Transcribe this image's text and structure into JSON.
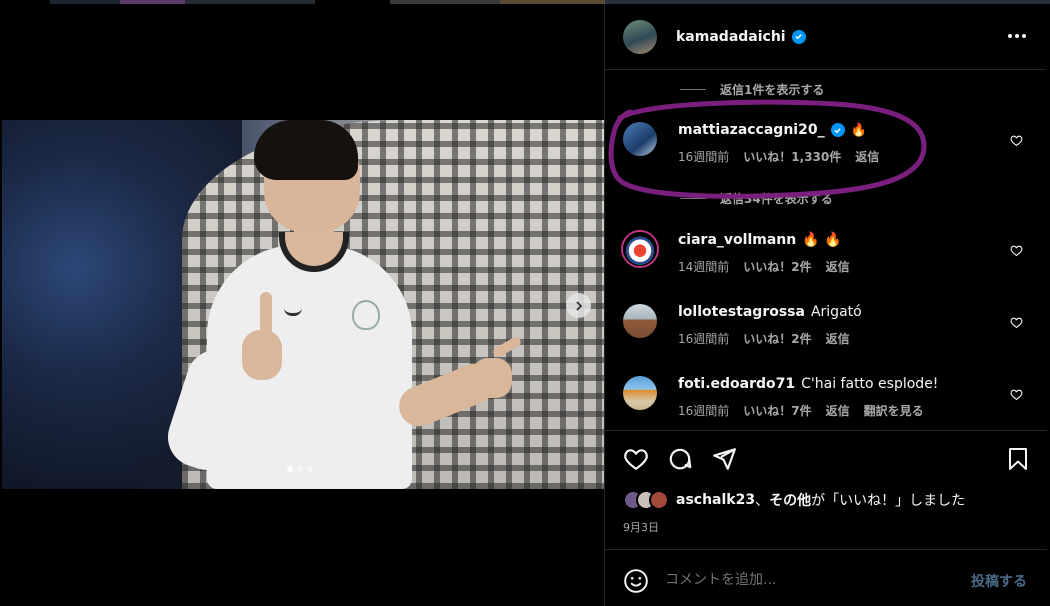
{
  "header": {
    "username": "kamadadaichi",
    "verified": true,
    "more_icon": "more-horizontal-icon"
  },
  "view_replies_top": "返信1件を表示する",
  "highlighted_comment": {
    "username": "mattiazaccagni20_",
    "verified": true,
    "emoji": "🔥",
    "time": "16週間前",
    "likes": "いいね！1,330件",
    "reply": "返信",
    "view_replies": "返信34件を表示する"
  },
  "comments": [
    {
      "username": "ciara_vollmann",
      "text": "🔥 🔥",
      "time": "14週間前",
      "likes": "いいね！2件",
      "reply": "返信",
      "extra": ""
    },
    {
      "username": "lollotestagrossa",
      "text": "Arigató",
      "time": "16週間前",
      "likes": "いいね！2件",
      "reply": "返信",
      "extra": ""
    },
    {
      "username": "foti.edoardo71",
      "text": "C'hai fatto esplode!",
      "time": "16週間前",
      "likes": "いいね！7件",
      "reply": "返信",
      "extra": "翻訳を見る"
    }
  ],
  "liked_by": {
    "user": "aschalk23",
    "sep": "、",
    "others": "その他",
    "suffix": "が「いいね！」しました"
  },
  "post_date": "9月3日",
  "comment_box": {
    "placeholder": "コメントを追加...",
    "post_label": "投稿する"
  },
  "carousel": {
    "current": 1,
    "total": 3
  },
  "colors": {
    "accent": "#0095f6",
    "annotation": "#7a1f7e",
    "background": "#000000"
  }
}
